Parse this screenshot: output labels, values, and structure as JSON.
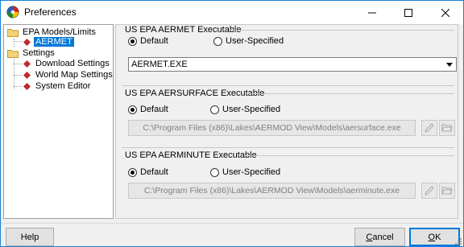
{
  "window": {
    "title": "Preferences"
  },
  "tree": {
    "groups": [
      {
        "label": "EPA Models/Limits",
        "children": [
          {
            "label": "AERMET",
            "selected": true
          }
        ]
      },
      {
        "label": "Settings",
        "children": [
          {
            "label": "Download Settings"
          },
          {
            "label": "World Map Settings"
          },
          {
            "label": "System Editor"
          }
        ]
      }
    ]
  },
  "aermet": {
    "title": "US EPA AERMET Executable",
    "default_label": "Default",
    "user_label": "User-Specified",
    "selected": "Default",
    "combo_value": "AERMET.EXE"
  },
  "aersurface": {
    "title": "US EPA AERSURFACE Executable",
    "default_label": "Default",
    "user_label": "User-Specified",
    "selected": "Default",
    "path": "C:\\Program Files (x86)\\Lakes\\AERMOD View\\Models\\aersurface.exe"
  },
  "aerminute": {
    "title": "US EPA AERMINUTE Executable",
    "default_label": "Default",
    "user_label": "User-Specified",
    "selected": "Default",
    "path": "C:\\Program Files (x86)\\Lakes\\AERMOD View\\Models\\aerminute.exe"
  },
  "footer": {
    "help": "Help",
    "cancel_pre": "",
    "cancel_key": "C",
    "cancel_post": "ancel",
    "ok_key": "O",
    "ok_post": "K"
  },
  "colors": {
    "selection": "#0078d7",
    "title_border": "#1883d7",
    "bullet_red": "#c0282d"
  },
  "icons": {
    "app": "app-logo-icon",
    "minimize": "minimize-icon",
    "maximize": "maximize-icon",
    "close": "close-icon",
    "folder": "folder-icon",
    "bullet": "red-diamond-icon",
    "edit": "pencil-icon",
    "browse": "open-folder-icon",
    "dropdown": "chevron-down-icon"
  }
}
